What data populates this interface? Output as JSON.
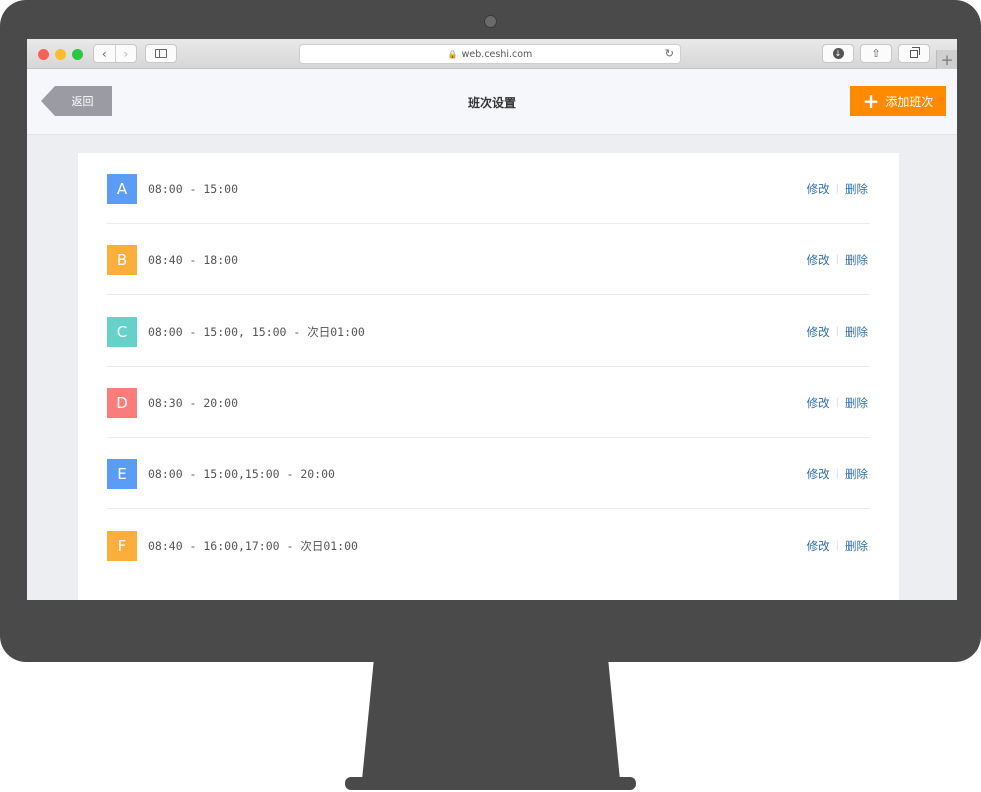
{
  "browser": {
    "url": "web.ceshi.com"
  },
  "header": {
    "back_label": "返回",
    "title": "班次设置",
    "add_label": "添加班次"
  },
  "shifts": [
    {
      "code": "A",
      "time": "08:00 - 15:00",
      "color": "#5b9cf6"
    },
    {
      "code": "B",
      "time": "08:40 - 18:00",
      "color": "#fbaf3a"
    },
    {
      "code": "C",
      "time": "08:00 - 15:00, 15:00 - 次日01:00",
      "color": "#66d1c8"
    },
    {
      "code": "D",
      "time": "08:30 - 20:00",
      "color": "#fb7d7b"
    },
    {
      "code": "E",
      "time": "08:00 - 15:00,15:00 - 20:00",
      "color": "#5b9cf6"
    },
    {
      "code": "F",
      "time": "08:40 - 16:00,17:00 - 次日01:00",
      "color": "#fbaf3a"
    }
  ],
  "row_actions": {
    "edit_label": "修改",
    "delete_label": "删除"
  },
  "colors": {
    "accent": "#ff8a00",
    "link": "#2f6fad"
  }
}
